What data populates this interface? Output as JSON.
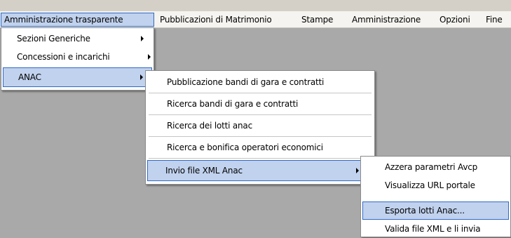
{
  "menubar": {
    "items": [
      {
        "label": "Amministrazione trasparente"
      },
      {
        "label": "Pubblicazioni di Matrimonio"
      },
      {
        "label": "Stampe"
      },
      {
        "label": "Amministrazione"
      },
      {
        "label": "Opzioni"
      },
      {
        "label": "Fine"
      }
    ]
  },
  "menu1": {
    "items": [
      {
        "label": "Sezioni Generiche"
      },
      {
        "label": "Concessioni e incarichi"
      },
      {
        "label": "ANAC"
      }
    ]
  },
  "menu2": {
    "items": [
      {
        "label": "Pubblicazione bandi di gara e contratti"
      },
      {
        "label": "Ricerca bandi di gara e contratti"
      },
      {
        "label": "Ricerca dei lotti anac"
      },
      {
        "label": "Ricerca e bonifica operatori economici"
      },
      {
        "label": "Invio file XML Anac"
      }
    ]
  },
  "menu3": {
    "items": [
      {
        "label": "Azzera parametri Avcp"
      },
      {
        "label": "Visualizza URL portale"
      },
      {
        "label": "Esporta lotti Anac..."
      },
      {
        "label": "Valida file XML e li invia"
      }
    ]
  },
  "colors": {
    "highlight": "#c1d2ee",
    "highlight_border": "#316ac5",
    "menubar_bg": "#f5f4f0",
    "desktop_bg": "#a9a9a9"
  }
}
